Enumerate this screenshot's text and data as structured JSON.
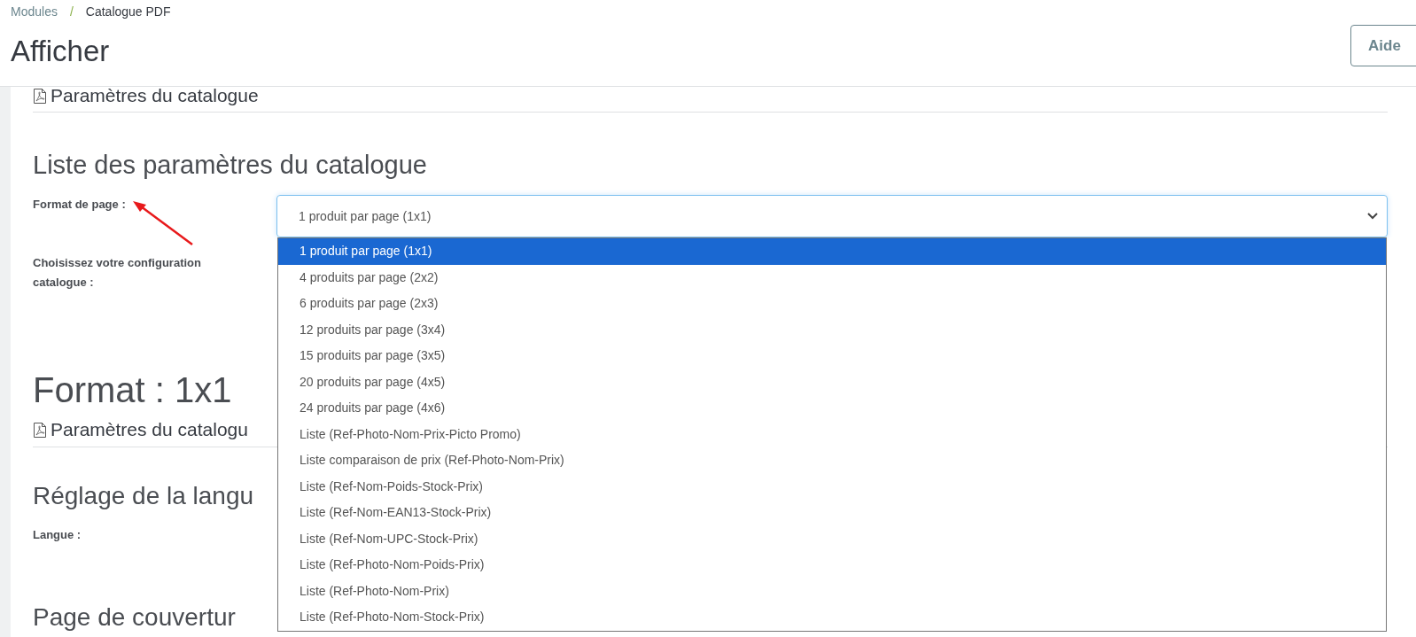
{
  "breadcrumb": [
    {
      "label": "Modules"
    },
    {
      "label": "Catalogue PDF"
    }
  ],
  "breadcrumb_separator": "/",
  "page_title": "Afficher",
  "help_button": "Aide",
  "top_subheading": "Paramètres du catalogue",
  "settings": {
    "title": "Liste des paramètres du catalogue",
    "fields": [
      {
        "label": "Format de page :",
        "select": {
          "value": "1 produit par page (1x1)",
          "expanded": true,
          "options": [
            {
              "label": "1 produit par page (1x1)",
              "selected": true
            },
            {
              "label": "4 produits par page (2x2)",
              "selected": false
            },
            {
              "label": "6 produits par page (2x3)",
              "selected": false
            },
            {
              "label": "12 produits par page (3x4)",
              "selected": false
            },
            {
              "label": "15 produits par page (3x5)",
              "selected": false
            },
            {
              "label": "20 produits par page (4x5)",
              "selected": false
            },
            {
              "label": "24 produits par page (4x6)",
              "selected": false
            },
            {
              "label": "Liste (Ref-Photo-Nom-Prix-Picto Promo)",
              "selected": false
            },
            {
              "label": "Liste comparaison de prix (Ref-Photo-Nom-Prix)",
              "selected": false
            },
            {
              "label": "Liste (Ref-Nom-Poids-Stock-Prix)",
              "selected": false
            },
            {
              "label": "Liste (Ref-Nom-EAN13-Stock-Prix)",
              "selected": false
            },
            {
              "label": "Liste (Ref-Nom-UPC-Stock-Prix)",
              "selected": false
            },
            {
              "label": "Liste (Ref-Photo-Nom-Poids-Prix)",
              "selected": false
            },
            {
              "label": "Liste (Ref-Photo-Nom-Prix)",
              "selected": false
            },
            {
              "label": "Liste (Ref-Photo-Nom-Stock-Prix)",
              "selected": false
            }
          ]
        }
      },
      {
        "label": "Choisissez votre configuration catalogue :"
      }
    ]
  },
  "format": {
    "title": "Format : 1x1",
    "subheading": "Paramètres du catalogu"
  },
  "language": {
    "title": "Réglage de la langu",
    "fields": [
      {
        "label": "Langue :"
      }
    ]
  },
  "cover": {
    "title": "Page de couvertur"
  }
}
